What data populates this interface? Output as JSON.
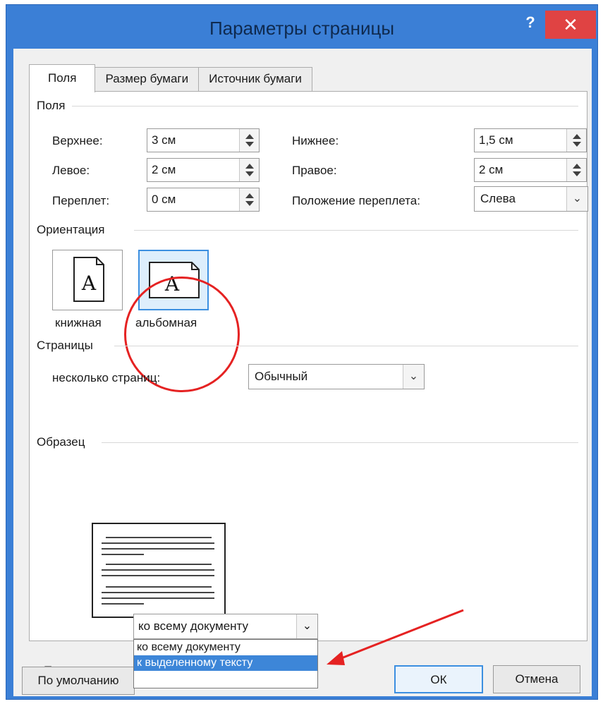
{
  "window": {
    "title": "Параметры страницы",
    "help": "?",
    "close": "✕"
  },
  "tabs": [
    {
      "label": "Поля"
    },
    {
      "label": "Размер бумаги"
    },
    {
      "label": "Источник бумаги"
    }
  ],
  "margins": {
    "group": "Поля",
    "top": {
      "label": "Верхнее:",
      "value": "3 см"
    },
    "bottom": {
      "label": "Нижнее:",
      "value": "1,5 см"
    },
    "left": {
      "label": "Левое:",
      "value": "2 см"
    },
    "right": {
      "label": "Правое:",
      "value": "2 см"
    },
    "gutter": {
      "label": "Переплет:",
      "value": "0 см"
    },
    "gutter_pos": {
      "label": "Положение переплета:",
      "value": "Слева"
    }
  },
  "orientation": {
    "group": "Ориентация",
    "portrait": "книжная",
    "landscape": "альбомная",
    "glyph": "A"
  },
  "pages": {
    "group": "Страницы",
    "label": "несколько страниц:",
    "value": "Обычный"
  },
  "sample": {
    "group": "Образец"
  },
  "apply": {
    "label": "Применить:",
    "value": "ко всему документу",
    "options": [
      "ко всему документу",
      "к выделенному тексту"
    ]
  },
  "buttons": {
    "default": "По умолчанию",
    "ok": "ОК",
    "cancel": "Отмена"
  },
  "colors": {
    "accent": "#3b7fd6",
    "close": "#e04343",
    "highlight": "#3d86d8",
    "annotation": "#e52222"
  }
}
